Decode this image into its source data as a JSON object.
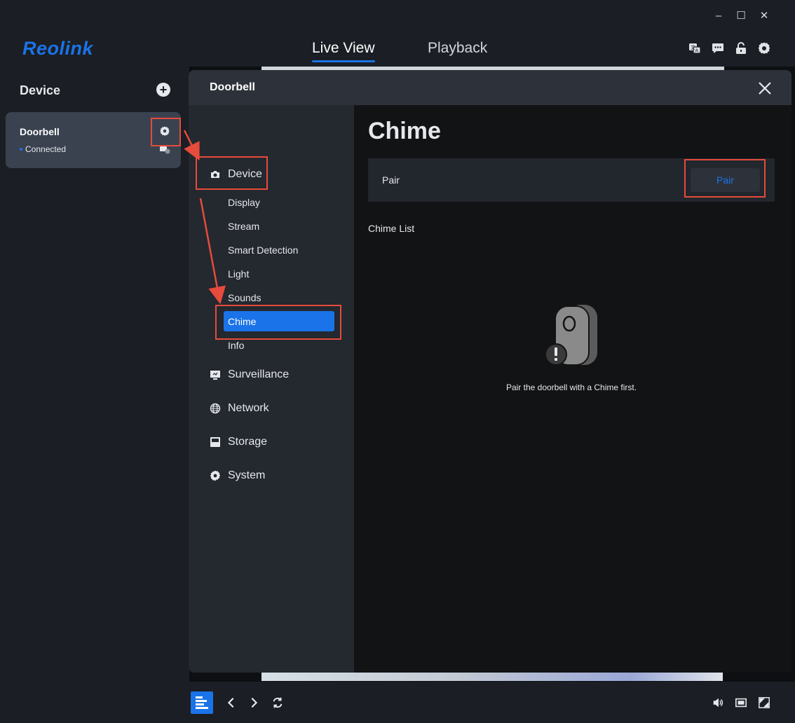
{
  "window": {
    "controls": {
      "minimize": "–",
      "maximize": "☐",
      "close": "✕"
    }
  },
  "header": {
    "logo": "Reolink",
    "tabs": [
      {
        "label": "Live View",
        "active": true
      },
      {
        "label": "Playback",
        "active": false
      }
    ],
    "icons": [
      "translate-icon",
      "feedback-icon",
      "unlock-icon",
      "settings-icon"
    ]
  },
  "sidebar": {
    "title": "Device",
    "device": {
      "name": "Doorbell",
      "status": "Connected"
    }
  },
  "modal": {
    "title": "Doorbell",
    "nav": {
      "device": "Device",
      "sub_items": [
        "Display",
        "Stream",
        "Smart Detection",
        "Light",
        "Sounds",
        "Chime",
        "Info"
      ],
      "active_sub": "Chime",
      "surveillance": "Surveillance",
      "network": "Network",
      "storage": "Storage",
      "system": "System"
    },
    "content": {
      "title": "Chime",
      "pair_label": "Pair",
      "pair_button": "Pair",
      "chime_list_label": "Chime List",
      "empty_message": "Pair the doorbell with a Chime first."
    }
  },
  "colors": {
    "accent": "#1a73e8",
    "annotation": "#e64b3c",
    "background": "#1b1e24"
  }
}
